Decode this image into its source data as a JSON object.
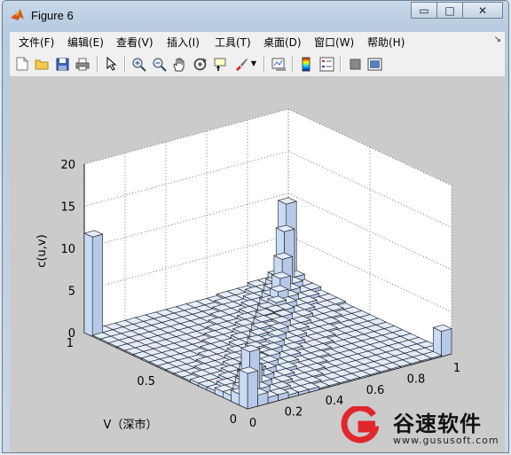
{
  "window": {
    "title": "Figure 6",
    "minimize_glyph": "▭",
    "maximize_glyph": "□",
    "close_glyph": "✕"
  },
  "menu": {
    "items": [
      {
        "label": "文件(F)"
      },
      {
        "label": "编辑(E)"
      },
      {
        "label": "查看(V)"
      },
      {
        "label": "插入(I)"
      },
      {
        "label": "工具(T)"
      },
      {
        "label": "桌面(D)"
      },
      {
        "label": "窗口(W)"
      },
      {
        "label": "帮助(H)"
      }
    ],
    "dock_arrow": "↘"
  },
  "toolbar": {
    "icons": [
      "new-file-icon",
      "open-folder-icon",
      "save-icon",
      "print-icon",
      "pointer-arrow-icon",
      "zoom-in-icon",
      "zoom-out-icon",
      "pan-hand-icon",
      "rotate-3d-icon",
      "data-cursor-icon",
      "brush-icon",
      "link-plot-icon",
      "colorbar-icon",
      "legend-icon",
      "hide-plot-tools-icon",
      "show-plot-tools-icon"
    ]
  },
  "chart_data": {
    "type": "bar3",
    "title": "",
    "xlabel": "",
    "ylabel": "V（深市）",
    "zlabel": "c(u,v)",
    "xlim": [
      0,
      1
    ],
    "ylim": [
      0,
      1
    ],
    "zlim": [
      0,
      20
    ],
    "x_ticks": [
      "0",
      "0.2",
      "0.4",
      "0.6",
      "0.8",
      "1"
    ],
    "y_ticks": [
      "0",
      "0.5",
      "1"
    ],
    "z_ticks": [
      "0",
      "5",
      "10",
      "15",
      "20"
    ],
    "grid": true,
    "bar_color": "#c9daf5",
    "grid_cells": 20,
    "diagonal_bars": [
      {
        "u": 0.02,
        "v": 0.02,
        "c": 4.2
      },
      {
        "u": 0.07,
        "v": 0.07,
        "c": 6.0
      },
      {
        "u": 0.12,
        "v": 0.12,
        "c": 3.5
      },
      {
        "u": 0.17,
        "v": 0.17,
        "c": 2.0
      },
      {
        "u": 0.22,
        "v": 0.22,
        "c": 1.6
      },
      {
        "u": 0.27,
        "v": 0.27,
        "c": 1.3
      },
      {
        "u": 0.32,
        "v": 0.32,
        "c": 1.2
      },
      {
        "u": 0.37,
        "v": 0.37,
        "c": 1.1
      },
      {
        "u": 0.42,
        "v": 0.42,
        "c": 1.0
      },
      {
        "u": 0.47,
        "v": 0.47,
        "c": 1.0
      },
      {
        "u": 0.52,
        "v": 0.52,
        "c": 1.0
      },
      {
        "u": 0.57,
        "v": 0.57,
        "c": 1.1
      },
      {
        "u": 0.62,
        "v": 0.62,
        "c": 1.2
      },
      {
        "u": 0.67,
        "v": 0.67,
        "c": 1.4
      },
      {
        "u": 0.72,
        "v": 0.72,
        "c": 1.7
      },
      {
        "u": 0.77,
        "v": 0.77,
        "c": 2.2
      },
      {
        "u": 0.82,
        "v": 0.82,
        "c": 3.0
      },
      {
        "u": 0.87,
        "v": 0.87,
        "c": 4.5
      },
      {
        "u": 0.92,
        "v": 0.92,
        "c": 7.0
      },
      {
        "u": 0.97,
        "v": 0.97,
        "c": 9.5
      }
    ],
    "corner_bars": [
      {
        "u": 0.02,
        "v": 0.97,
        "c": 11.8
      },
      {
        "u": 0.97,
        "v": 0.02,
        "c": 3.0
      }
    ]
  },
  "watermark": {
    "name": "谷速软件",
    "url": "www.gususoft.com"
  }
}
